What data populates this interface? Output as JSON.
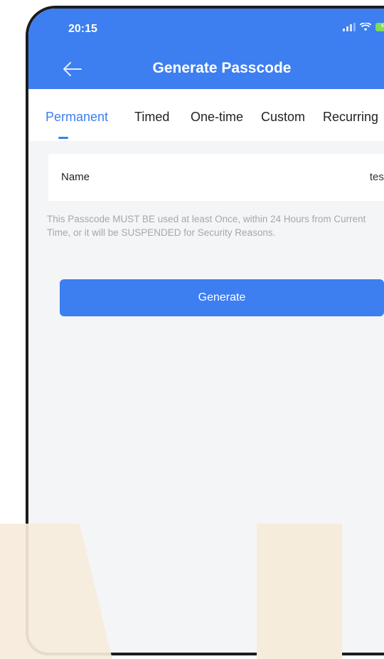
{
  "status_bar": {
    "time": "20:15"
  },
  "header": {
    "title": "Generate Passcode",
    "back_icon": "arrow-left-icon"
  },
  "tabs": [
    {
      "label": "Permanent",
      "active": true
    },
    {
      "label": "Timed",
      "active": false
    },
    {
      "label": "One-time",
      "active": false
    },
    {
      "label": "Custom",
      "active": false
    },
    {
      "label": "Recurring",
      "active": false
    }
  ],
  "form": {
    "name_label": "Name",
    "name_value": "test"
  },
  "notice": "This Passcode MUST BE used at least Once, within 24 Hours from Current Time, or it will be SUSPENDED for Security Reasons.",
  "generate_label": "Generate",
  "colors": {
    "accent": "#3d7ef0",
    "background": "#f4f5f7",
    "deco": "#f6ecdc"
  }
}
